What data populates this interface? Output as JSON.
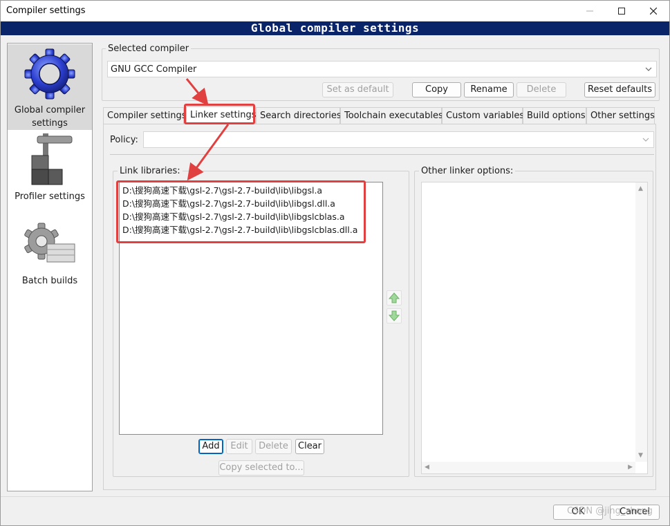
{
  "window": {
    "title": "Compiler settings"
  },
  "banner": {
    "title": "Global compiler settings"
  },
  "sidebar": {
    "items": [
      {
        "label": "Global compiler settings",
        "icon": "gear-icon"
      },
      {
        "label": "Profiler settings",
        "icon": "profiler-icon"
      },
      {
        "label": "Batch builds",
        "icon": "batch-gear-icon"
      }
    ]
  },
  "compiler": {
    "group_label": "Selected compiler",
    "selected": "GNU GCC Compiler",
    "buttons": {
      "set_default": "Set as default",
      "copy": "Copy",
      "rename": "Rename",
      "delete": "Delete",
      "reset_defaults": "Reset defaults"
    }
  },
  "tabs": [
    "Compiler settings",
    "Linker settings",
    "Search directories",
    "Toolchain executables",
    "Custom variables",
    "Build options",
    "Other settings"
  ],
  "linker": {
    "policy_label": "Policy:",
    "policy_value": "",
    "link_libraries_label": "Link libraries:",
    "libraries": [
      "D:\\搜狗高速下载\\gsl-2.7\\gsl-2.7-build\\lib\\libgsl.a",
      "D:\\搜狗高速下载\\gsl-2.7\\gsl-2.7-build\\lib\\libgsl.dll.a",
      "D:\\搜狗高速下载\\gsl-2.7\\gsl-2.7-build\\lib\\libgslcblas.a",
      "D:\\搜狗高速下载\\gsl-2.7\\gsl-2.7-build\\lib\\libgslcblas.dll.a"
    ],
    "buttons": {
      "add": "Add",
      "edit": "Edit",
      "delete": "Delete",
      "clear": "Clear",
      "copy_selected": "Copy selected to..."
    },
    "other_options_label": "Other linker options:",
    "other_options_value": ""
  },
  "footer": {
    "ok": "OK",
    "cancel": "Cancel",
    "watermark": "CSDN @jing_zhong"
  },
  "colors": {
    "banner_bg": "#0a246a",
    "annotation_red": "#e04040",
    "focus_blue": "#0067c0"
  }
}
